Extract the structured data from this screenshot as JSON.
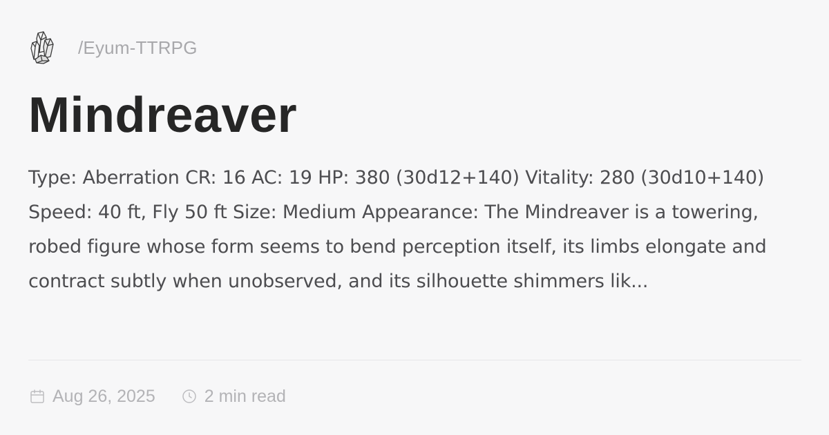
{
  "site": {
    "logo_icon": "crystal-cluster-icon",
    "path": "/Eyum-TTRPG"
  },
  "page": {
    "title": "Mindreaver",
    "excerpt": "Type: Aberration CR: 16 AC: 19 HP: 380 (30d12+140) Vitality: 280 (30d10+140) Speed: 40 ft, Fly 50 ft Size: Medium Appearance: The Mindreaver is a towering, robed figure whose form seems to bend perception itself, its limbs elongate and contract subtly when unobserved, and its silhouette shimmers lik..."
  },
  "meta": {
    "date_icon": "calendar-icon",
    "date": "Aug 26, 2025",
    "read_time_icon": "clock-icon",
    "read_time": "2 min read"
  },
  "colors": {
    "background": "#f7f7f8",
    "title": "#262626",
    "body_text": "#4d4d50",
    "muted_text": "#b3b3b6",
    "divider": "#e6e6e8"
  }
}
